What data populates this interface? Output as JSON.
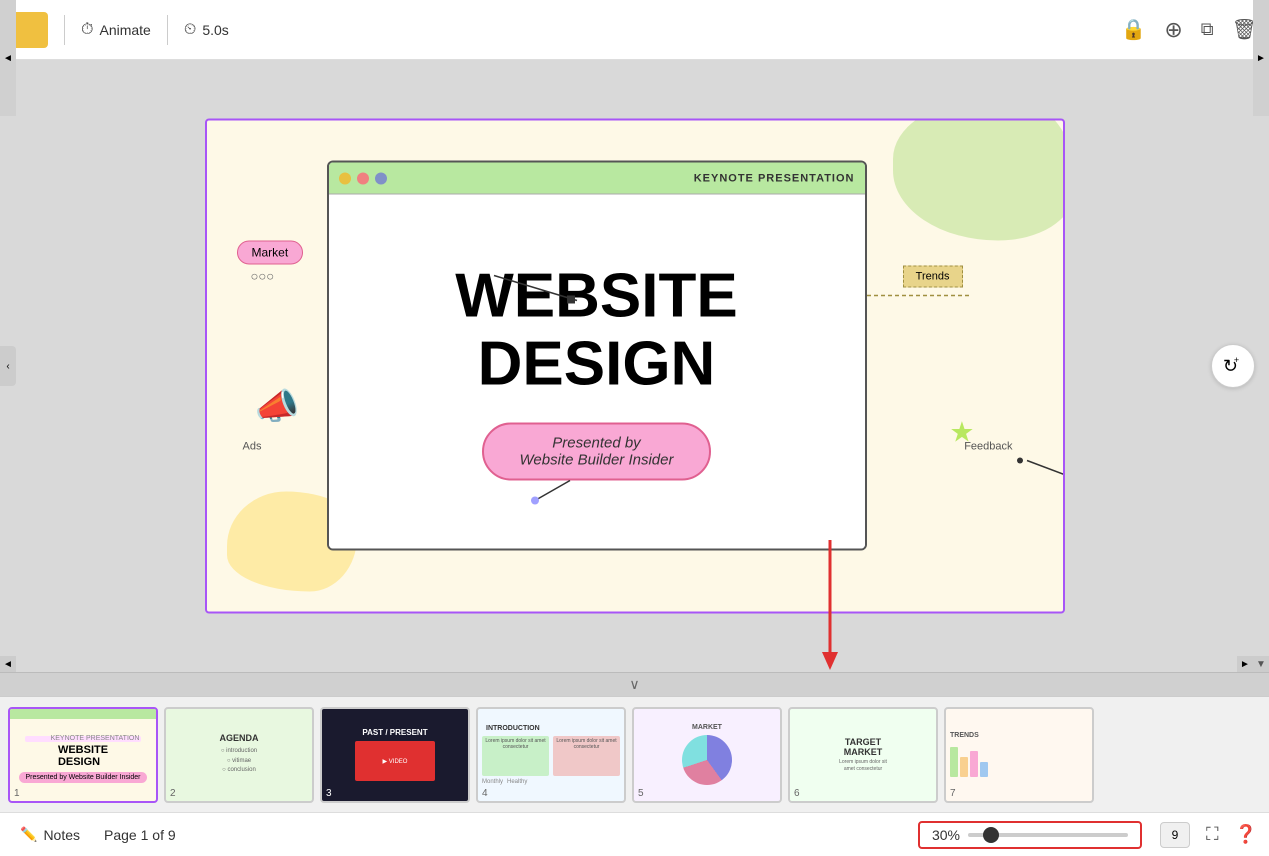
{
  "toolbar": {
    "animate_label": "Animate",
    "duration_label": "5.0s",
    "icons": {
      "lock": "🔒",
      "add_slide": "⊕",
      "duplicate": "⧉",
      "trash": "🗑"
    }
  },
  "slide": {
    "keynote_title": "KEYNOTE PRESENTATION",
    "main_title_line1": "WEBSITE",
    "main_title_line2": "DESIGN",
    "subtitle": "Presented by\nWebsite Builder Insider",
    "float_labels": {
      "market": "Market",
      "ads": "Ads",
      "trends": "Trends",
      "feedback": "Feedback"
    }
  },
  "filmstrip": {
    "slides": [
      {
        "num": "1",
        "label": "WEBSITE DESIGN",
        "active": true,
        "theme": "light"
      },
      {
        "num": "2",
        "label": "AGENDA",
        "active": false,
        "theme": "green"
      },
      {
        "num": "3",
        "label": "PAST / PRESENT",
        "active": false,
        "theme": "dark"
      },
      {
        "num": "4",
        "label": "INTRODUCTION",
        "active": false,
        "theme": "blue"
      },
      {
        "num": "5",
        "label": "",
        "active": false,
        "theme": "purple"
      },
      {
        "num": "6",
        "label": "TARGET MARKET",
        "active": false,
        "theme": "light"
      },
      {
        "num": "7",
        "label": "TRENDS",
        "active": false,
        "theme": "warm"
      }
    ]
  },
  "bottom_bar": {
    "notes_label": "Notes",
    "page_info": "Page 1 of 9",
    "zoom_value": "30%",
    "page_count": "9"
  },
  "refresh_icon": "↻",
  "collapse_icon": "∨",
  "left_toggle_icon": "‹"
}
